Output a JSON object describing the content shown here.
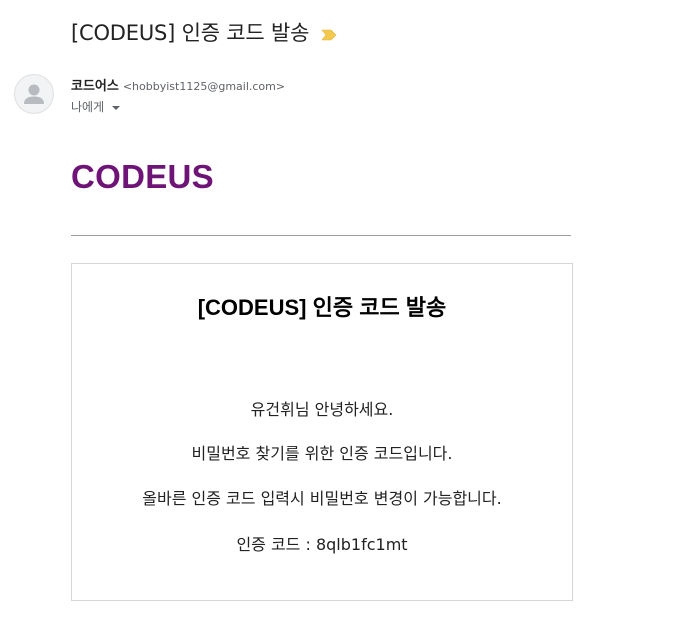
{
  "email": {
    "subject": "[CODEUS] 인증 코드 발송",
    "sender": {
      "name": "코드어스",
      "email": "<hobbyist1125@gmail.com>"
    },
    "recipient_label": "나에게",
    "brand": "CODEUS",
    "card": {
      "title": "[CODEUS] 인증 코드 발송",
      "lines": [
        "유건휘님 안녕하세요.",
        "비밀번호 찾기를 위한 인증 코드입니다.",
        "올바른 인증 코드 입력시 비밀번호 변경이 가능합니다.",
        "인증 코드 : 8qlb1fc1mt"
      ]
    }
  },
  "icons": {
    "important": "important-marker-icon",
    "avatar": "person-icon",
    "dropdown": "chevron-down-icon"
  },
  "colors": {
    "brand": "#6e1477",
    "important_marker": "#f2c94c",
    "divider": "#9e9e9e",
    "card_border": "#d6d6d6"
  }
}
